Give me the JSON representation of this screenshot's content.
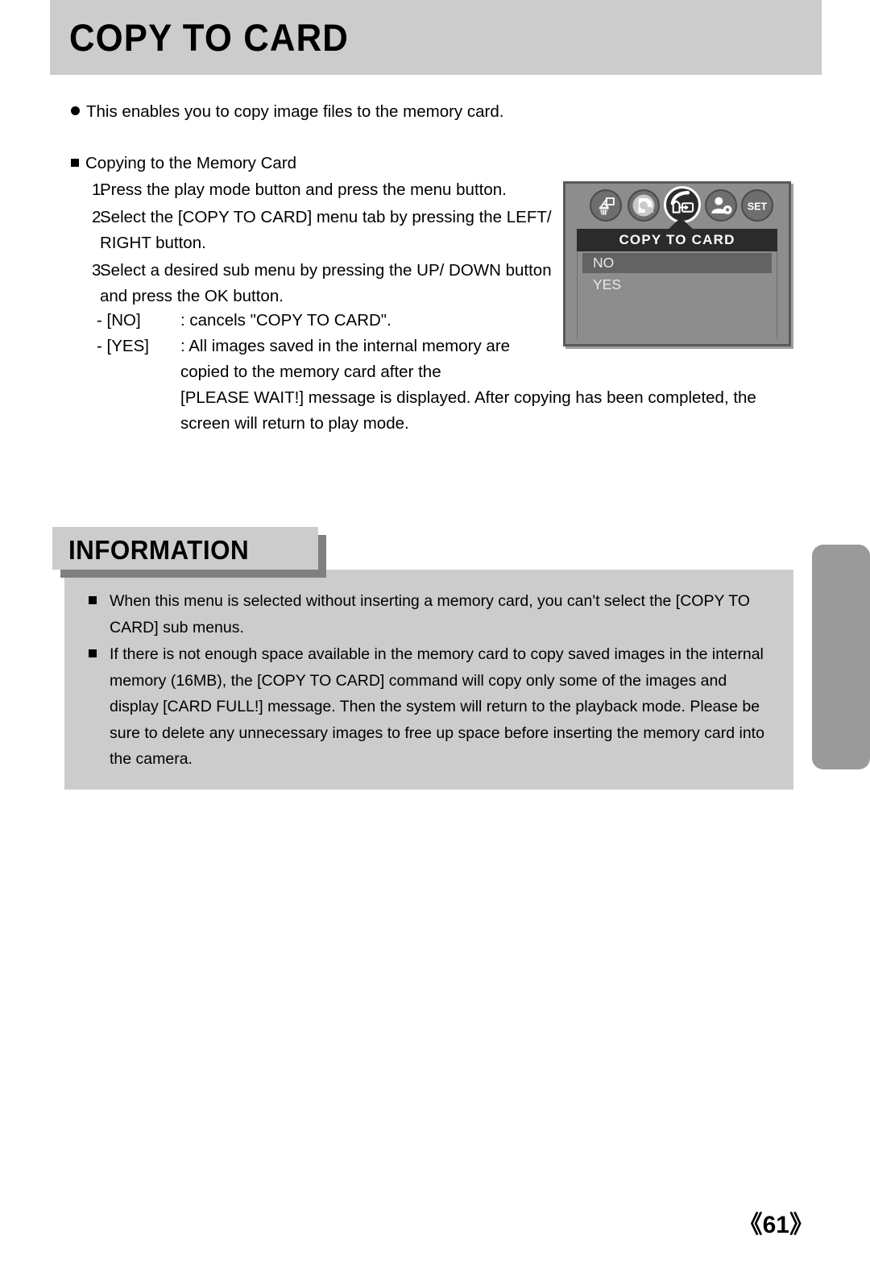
{
  "header": {
    "title": "COPY TO CARD",
    "background_color": "#cccccc"
  },
  "intro": {
    "bullet": "circle",
    "text": "This enables you to copy image files to the memory card."
  },
  "procedure": {
    "heading": "Copying to the Memory Card",
    "steps": [
      {
        "number": "1.",
        "text": "Press the play mode button and press the menu button."
      },
      {
        "number": "2.",
        "text": "Select the [COPY TO CARD] menu tab by pressing the LEFT/ RIGHT button."
      },
      {
        "number": "3.",
        "text": "Select a desired sub menu by pressing the UP/ DOWN button and press the OK button."
      }
    ],
    "sub_options": [
      {
        "key": "- [NO]",
        "desc": ": cancels \"COPY TO CARD\"."
      },
      {
        "key": "- [YES]",
        "desc": ": All images saved in the internal memory are"
      }
    ],
    "continuation": [
      "copied to the memory card after the",
      "[PLEASE WAIT!] message is displayed. After copying has been completed, the",
      "screen will return to play mode."
    ]
  },
  "lcd": {
    "menu_title": "COPY TO CARD",
    "icons": [
      {
        "name": "delete-icon",
        "selected": false
      },
      {
        "name": "dpof-icon",
        "selected": false
      },
      {
        "name": "copy-to-card-icon",
        "selected": true
      },
      {
        "name": "protect-icon",
        "selected": false
      },
      {
        "name": "set-icon",
        "label": "SET",
        "selected": false
      }
    ],
    "options": [
      {
        "label": "NO",
        "selected": true
      },
      {
        "label": "YES",
        "selected": false
      }
    ],
    "screen_color": "#8d8d8d",
    "title_bar_color": "#2b2b2b",
    "highlight_color": "#636363"
  },
  "information": {
    "tab_label": "INFORMATION",
    "items": [
      "When this menu is selected without inserting a memory card, you can't select the [COPY TO CARD] sub menus.",
      "If there is not enough space available in the memory card to copy saved images in the internal memory (16MB), the [COPY TO CARD] command will copy only some of the images and display [CARD FULL!] message. Then the system will return to the playback mode. Please be sure to delete any unnecessary images to free up space before inserting the memory card into the camera."
    ],
    "box_color": "#cccccc",
    "tab_shadow_color": "#808080"
  },
  "footer": {
    "page_number": "《61》"
  },
  "bleed_tab": {
    "color": "#9a9a9a"
  }
}
